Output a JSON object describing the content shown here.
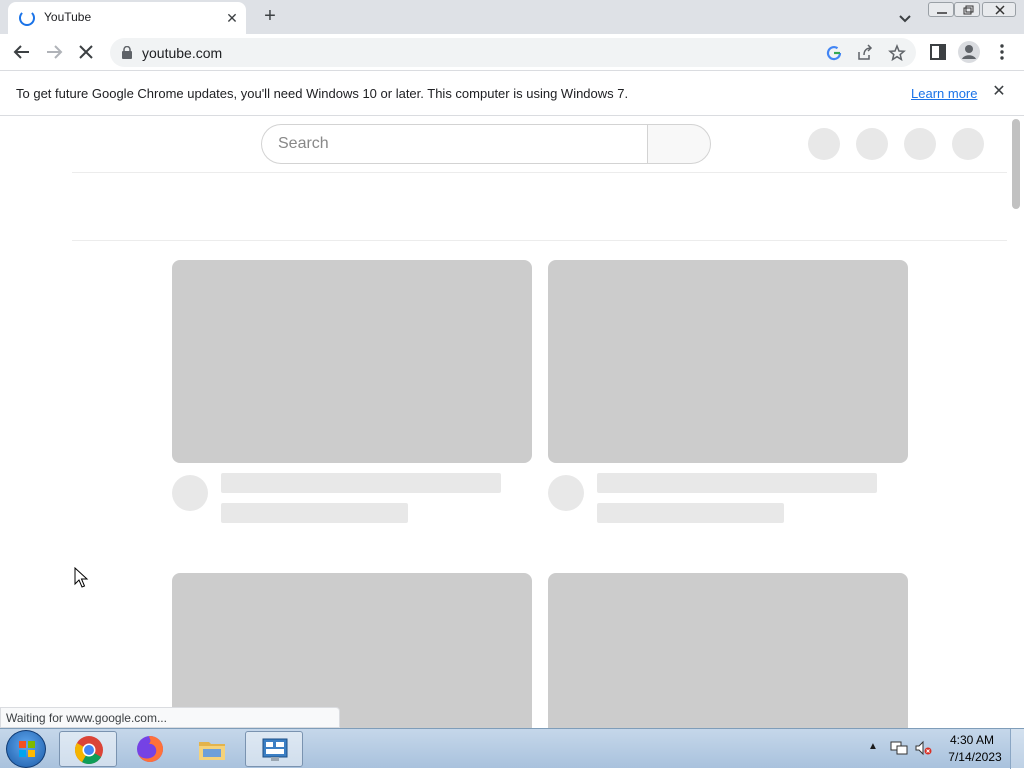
{
  "browser": {
    "tab": {
      "title": "YouTube"
    },
    "address": {
      "url": "youtube.com"
    },
    "infobar": {
      "message": "To get future Google Chrome updates, you'll need Windows 10 or later. This computer is using Windows 7.",
      "link": "Learn more"
    },
    "status": "Waiting for www.google.com..."
  },
  "page": {
    "search": {
      "placeholder": "Search"
    },
    "video_placeholders": 4
  },
  "taskbar": {
    "apps": [
      "chrome-icon",
      "firefox-icon",
      "file-explorer-icon",
      "control-panel-icon"
    ],
    "clock": {
      "time": "4:30 AM",
      "date": "7/14/2023"
    }
  },
  "colors": {
    "accent": "#1a73e8",
    "skeleton": "#cccccc",
    "skeleton_light": "#e8e8e8"
  }
}
